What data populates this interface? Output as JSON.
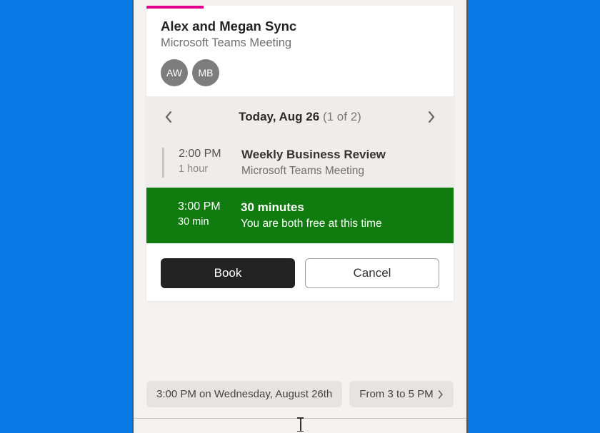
{
  "meeting": {
    "title": "Alex and Megan Sync",
    "subtitle": "Microsoft Teams Meeting",
    "attendees": [
      {
        "initials": "AW"
      },
      {
        "initials": "MB"
      }
    ]
  },
  "dateNav": {
    "dateBold": "Today, Aug 26",
    "pager": "(1 of 2)"
  },
  "slots": [
    {
      "time": "2:00 PM",
      "duration": "1 hour",
      "title": "Weekly Business Review",
      "subtitle": "Microsoft Teams Meeting",
      "selected": false
    },
    {
      "time": "3:00 PM",
      "duration": "30 min",
      "title": "30 minutes",
      "subtitle": "You are both free at this time",
      "selected": true
    }
  ],
  "actions": {
    "book": "Book",
    "cancel": "Cancel"
  },
  "chips": [
    "3:00 PM on Wednesday, August 26th",
    "From 3 to 5 PM"
  ],
  "colors": {
    "accent": "#e3008c",
    "selected_bg": "#107c10"
  }
}
